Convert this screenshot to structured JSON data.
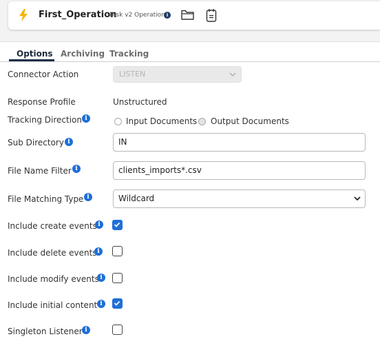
{
  "operation": {
    "title": "First_Operation",
    "subtitle": "Disk v2 Operation",
    "icons": [
      "lightning-icon",
      "info-icon",
      "folder-icon",
      "notes-icon"
    ]
  },
  "tabs": [
    {
      "label": "Options",
      "active": true
    },
    {
      "label": "Archiving",
      "active": false
    },
    {
      "label": "Tracking",
      "active": false
    }
  ],
  "form": {
    "connector_action": {
      "label": "Connector Action",
      "value": "LISTEN",
      "disabled": true
    },
    "response_profile": {
      "label": "Response Profile",
      "value": "Unstructured"
    },
    "tracking_direction": {
      "label": "Tracking Direction",
      "options": [
        "Input Documents",
        "Output Documents"
      ],
      "selected": "Output Documents"
    },
    "sub_directory": {
      "label": "Sub Directory",
      "value": "IN"
    },
    "file_name_filter": {
      "label": "File Name Filter",
      "value": "clients_imports*.csv"
    },
    "file_matching_type": {
      "label": "File Matching Type",
      "value": "Wildcard"
    },
    "include_create_events": {
      "label": "Include create events",
      "checked": true
    },
    "include_delete_events": {
      "label": "Include delete events",
      "checked": false
    },
    "include_modify_events": {
      "label": "Include modify events",
      "checked": false
    },
    "include_initial_content": {
      "label": "Include initial content",
      "checked": true
    },
    "singleton_listener": {
      "label": "Singleton Listener",
      "checked": false
    }
  },
  "colors": {
    "accent": "#1e6fd9",
    "bolt": "#f5b400",
    "tab_active": "#1b2f4a"
  }
}
